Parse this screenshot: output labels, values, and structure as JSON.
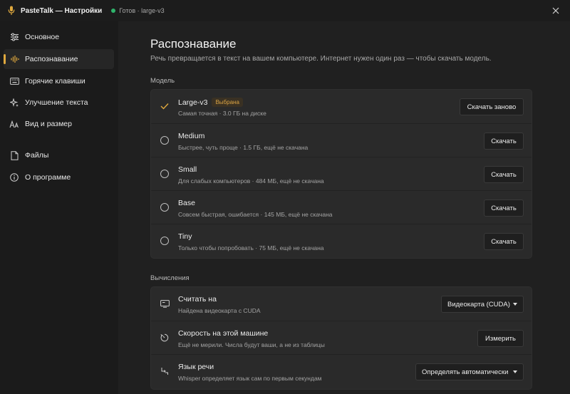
{
  "window": {
    "title": "PasteTalk — Настройки",
    "status": "Готов · large-v3",
    "status_color": "#2fb36b",
    "accent": "#e0a93e"
  },
  "sidebar": {
    "items": [
      {
        "label": "Основное",
        "icon": "sliders-icon"
      },
      {
        "label": "Распознавание",
        "icon": "waveform-icon",
        "active": true
      },
      {
        "label": "Горячие клавиши",
        "icon": "keyboard-icon"
      },
      {
        "label": "Улучшение текста",
        "icon": "sparkle-icon"
      },
      {
        "label": "Вид и размер",
        "icon": "font-size-icon"
      },
      {
        "label": "Файлы",
        "icon": "document-icon"
      },
      {
        "label": "О программе",
        "icon": "info-icon"
      }
    ]
  },
  "main": {
    "title": "Распознавание",
    "subtitle": "Речь превращается в текст на вашем компьютере. Интернет нужен один раз — чтобы скачать модель.",
    "model_section": "Модель",
    "models": [
      {
        "name": "Large-v3",
        "badge": "Выбрана",
        "desc": "Самая точная · 3.0 ГБ на диске",
        "button": "Скачать заново",
        "selected": true
      },
      {
        "name": "Medium",
        "desc": "Быстрее, чуть проще · 1.5 ГБ, ещё не скачана",
        "button": "Скачать"
      },
      {
        "name": "Small",
        "desc": "Для слабых компьютеров · 484 МБ, ещё не скачана",
        "button": "Скачать"
      },
      {
        "name": "Base",
        "desc": "Совсем быстрая, ошибается · 145 МБ, ещё не скачана",
        "button": "Скачать"
      },
      {
        "name": "Tiny",
        "desc": "Только чтобы попробовать · 75 МБ, ещё не скачана",
        "button": "Скачать"
      }
    ],
    "compute_section": "Вычисления",
    "compute": [
      {
        "name": "Считать на",
        "desc": "Найдена видеокарта с CUDA",
        "control": "dropdown",
        "value": "Видеокарта (CUDA)",
        "icon": "monitor-icon"
      },
      {
        "name": "Скорость на этой машине",
        "desc": "Ещё не мерили. Числа будут ваши, а не из таблицы",
        "control": "button",
        "value": "Измерить",
        "icon": "timer-icon"
      },
      {
        "name": "Язык речи",
        "desc": "Whisper определяет язык сам по первым секундам",
        "control": "dropdown",
        "value": "Определять автоматически",
        "icon": "language-icon"
      }
    ]
  }
}
